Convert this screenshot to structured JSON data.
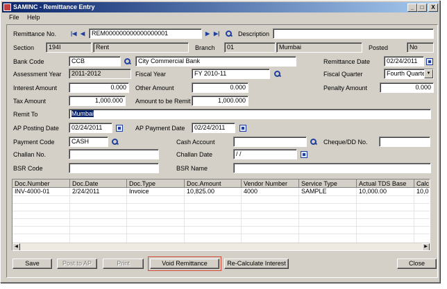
{
  "window": {
    "title": "SAMINC - Remittance Entry",
    "minimize": "_",
    "maximize": "□",
    "close": "X"
  },
  "menu": [
    "File",
    "Help"
  ],
  "form": {
    "remittance_no_label": "Remittance No.",
    "remittance_no": "REM000000000000000001",
    "description_label": "Description",
    "description": "",
    "section_label": "Section",
    "section_code": "194I",
    "section_name": "Rent",
    "branch_label": "Branch",
    "branch_code": "01",
    "branch_name": "Mumbai",
    "posted_label": "Posted",
    "posted": "No",
    "bank_code_label": "Bank Code",
    "bank_code": "CCB",
    "bank_name": "City Commercial Bank",
    "remittance_date_label": "Remittance Date",
    "remittance_date": "02/24/2011",
    "assessment_year_label": "Assessment Year",
    "assessment_year": "2011-2012",
    "fiscal_year_label": "Fiscal Year",
    "fiscal_year": "FY 2010-11",
    "fiscal_quarter_label": "Fiscal Quarter",
    "fiscal_quarter": "Fourth Quarter",
    "interest_amount_label": "Interest Amount",
    "interest_amount": "0.000",
    "other_amount_label": "Other Amount",
    "other_amount": "0.000",
    "penalty_amount_label": "Penalty Amount",
    "penalty_amount": "0.000",
    "tax_amount_label": "Tax Amount",
    "tax_amount": "1,000.000",
    "amount_to_remit_label": "Amount to be Remit",
    "amount_to_remit": "1,000.000",
    "remit_to_label": "Remit To",
    "remit_to": "Mumbai",
    "ap_posting_date_label": "AP Posting Date",
    "ap_posting_date": "02/24/2011",
    "ap_payment_date_label": "AP Payment Date",
    "ap_payment_date": "02/24/2011",
    "payment_code_label": "Payment Code",
    "payment_code": "CASH",
    "cash_account_label": "Cash Account",
    "cash_account": "",
    "cheque_label": "Cheque/DD No.",
    "cheque": "",
    "challan_no_label": "Challan No.",
    "challan_no": "",
    "challan_date_label": "Challan Date",
    "challan_date": " / /",
    "bsr_code_label": "BSR Code",
    "bsr_code": "",
    "bsr_name_label": "BSR Name",
    "bsr_name": ""
  },
  "grid": {
    "columns": [
      "Doc.Number",
      "Doc.Date",
      "Doc.Type",
      "Doc.Amount",
      "Vendor Number",
      "Service Type",
      "Actual TDS Base",
      "Calc"
    ],
    "rows": [
      [
        "INV-4000-01",
        "2/24/2011",
        "Invoice",
        "10,825.00",
        "4000",
        "SAMPLE",
        "10,000.00",
        "10,0"
      ]
    ]
  },
  "buttons": {
    "save": "Save",
    "post_to_ap": "Post to AP",
    "print": "Print",
    "void_remittance": "Void Remittance",
    "recalculate_interest": "Re-Calculate Interest",
    "close": "Close"
  },
  "icons": {
    "first": "first-record-icon",
    "prev": "previous-record-icon",
    "next": "next-record-icon",
    "last": "last-record-icon",
    "search": "search-icon",
    "calendar": "calendar-icon"
  },
  "colors": {
    "title_start": "#0a246a",
    "title_end": "#a6caf0",
    "highlight": "#d34a3a",
    "window_bg": "#d4d0c8"
  }
}
